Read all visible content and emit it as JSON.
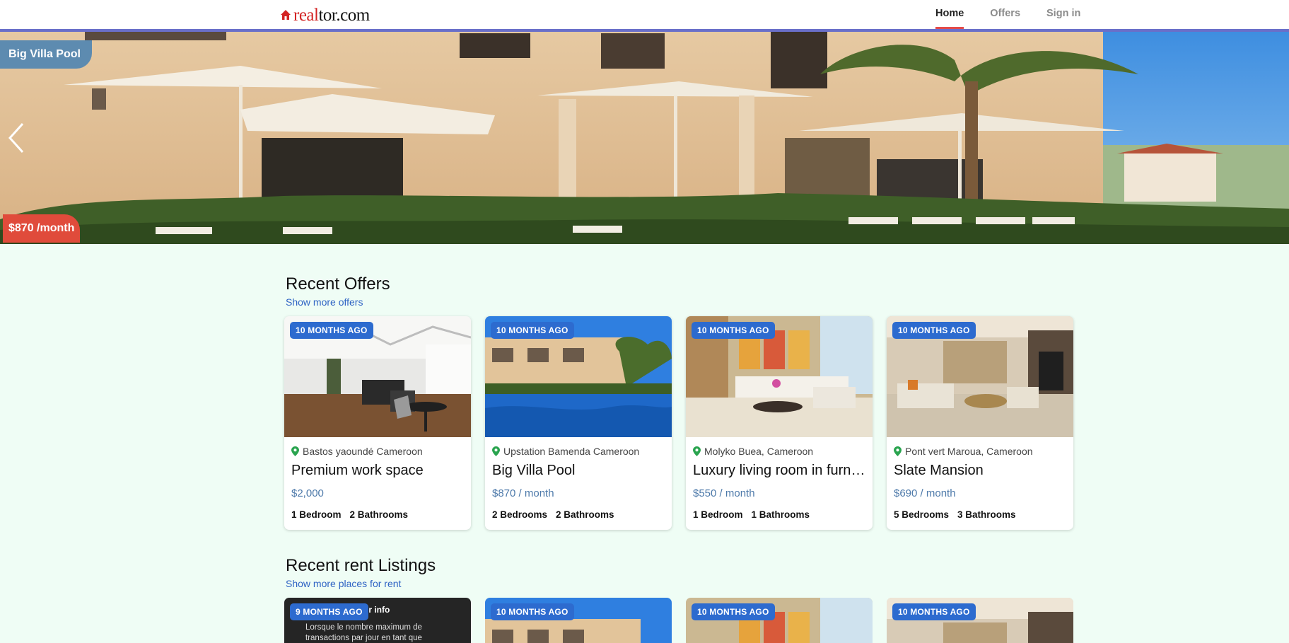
{
  "header": {
    "logo_red": "real",
    "logo_black": "tor.com",
    "nav": [
      {
        "label": "Home",
        "active": true
      },
      {
        "label": "Offers",
        "active": false
      },
      {
        "label": "Sign in",
        "active": false
      }
    ]
  },
  "hero": {
    "title": "Big Villa Pool",
    "price": "$870 /month",
    "prev_icon": "chevron-left-icon"
  },
  "offers": {
    "title": "Recent Offers",
    "link": "Show more offers",
    "items": [
      {
        "badge": "10 MONTHS AGO",
        "location": "Bastos yaoundé Cameroon",
        "name": "Premium work space",
        "price": "$2,000",
        "bedrooms": "1 Bedroom",
        "bathrooms": "2 Bathrooms"
      },
      {
        "badge": "10 MONTHS AGO",
        "location": "Upstation Bamenda Cameroon",
        "name": "Big Villa Pool",
        "price": "$870 / month",
        "bedrooms": "2 Bedrooms",
        "bathrooms": "2 Bathrooms"
      },
      {
        "badge": "10 MONTHS AGO",
        "location": "Molyko Buea, Cameroon",
        "name": "Luxury living room in furnished apartment",
        "price": "$550 / month",
        "bedrooms": "1 Bedroom",
        "bathrooms": "1 Bathrooms"
      },
      {
        "badge": "10 MONTHS AGO",
        "location": "Pont vert Maroua, Cameroon",
        "name": "Slate Mansion",
        "price": "$690 / month",
        "bedrooms": "5 Bedrooms",
        "bathrooms": "3 Bathrooms"
      }
    ]
  },
  "rent": {
    "title": "Recent rent Listings",
    "link": "Show more places for rent",
    "items": [
      {
        "badge": "9 MONTHS AGO",
        "overlay_title": "rrier info",
        "overlay_text": "Lorsque le nombre maximum de transactions par jour en tant que"
      },
      {
        "badge": "10 MONTHS AGO"
      },
      {
        "badge": "10 MONTHS AGO"
      },
      {
        "badge": "10 MONTHS AGO"
      }
    ]
  },
  "colors": {
    "accent": "#2d6bcf",
    "price": "#4e7aaa",
    "hero_price_bg": "#e04b3b",
    "hero_title_bg": "#5d8bb0",
    "nav_active_underline": "#e34b4b",
    "page_bg": "#effdf5"
  }
}
